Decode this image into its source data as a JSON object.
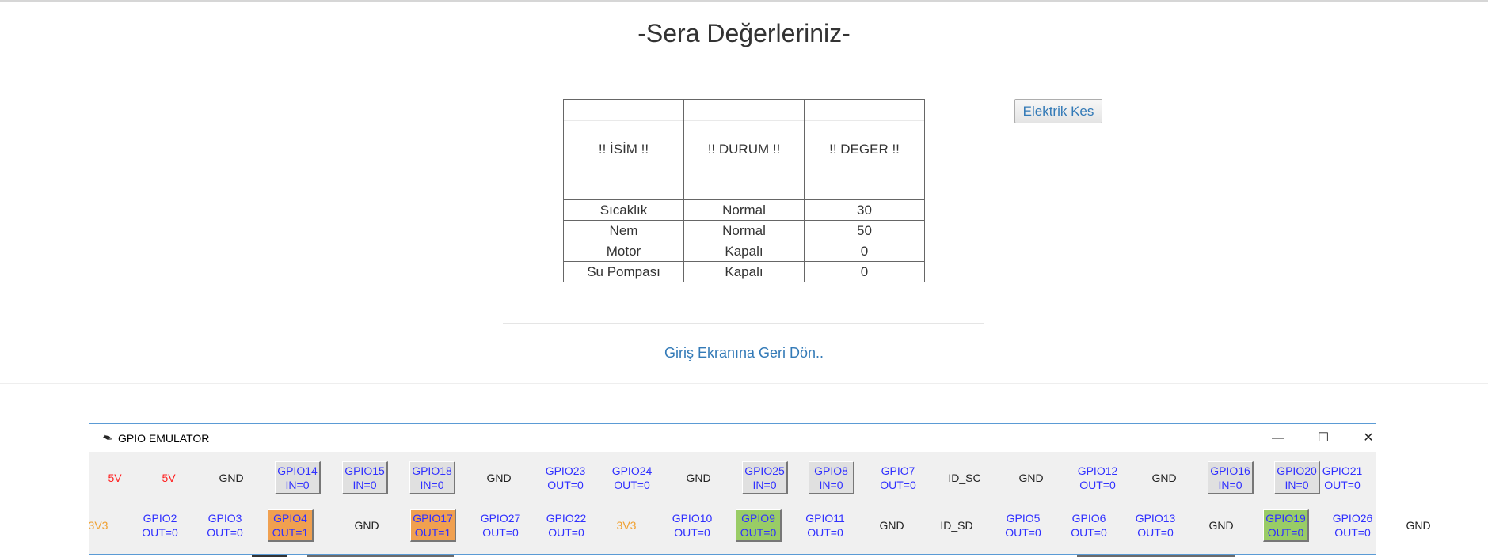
{
  "page": {
    "title": "-Sera Değerleriniz-",
    "cut_button": "Elektrik Kes",
    "back_link": "Giriş Ekranına Geri Dön.."
  },
  "table": {
    "headers": [
      "!! İSİM !!",
      "!! DURUM !!",
      "!! DEGER !!"
    ],
    "rows": [
      [
        "Sıcaklık",
        "Normal",
        "30"
      ],
      [
        "Nem",
        "Normal",
        "50"
      ],
      [
        "Motor",
        "Kapalı",
        "0"
      ],
      [
        "Su Pompası",
        "Kapalı",
        "0"
      ]
    ]
  },
  "emulator": {
    "title": "GPIO EMULATOR",
    "controls": {
      "minimize": "—",
      "maximize": "☐",
      "close": "✕"
    },
    "colors": {
      "power_5v": "#ff2020",
      "power_3v3": "#f0a030",
      "gpio_text": "#3030ff",
      "high": "#f0a050",
      "green": "#99cc66"
    },
    "row1": [
      {
        "l1": "5V",
        "l2": "",
        "kind": "5v"
      },
      {
        "l1": "5V",
        "l2": "",
        "kind": "5v"
      },
      {
        "l1": "GND",
        "l2": "",
        "kind": "gnd"
      },
      {
        "l1": "GPIO14",
        "l2": "IN=0",
        "kind": "in"
      },
      {
        "l1": "GPIO15",
        "l2": "IN=0",
        "kind": "in"
      },
      {
        "l1": "GPIO18",
        "l2": "IN=0",
        "kind": "in"
      },
      {
        "l1": "GND",
        "l2": "",
        "kind": "gnd"
      },
      {
        "l1": "GPIO23",
        "l2": "OUT=0",
        "kind": "out"
      },
      {
        "l1": "GPIO24",
        "l2": "OUT=0",
        "kind": "out"
      },
      {
        "l1": "GND",
        "l2": "",
        "kind": "gnd"
      },
      {
        "l1": "GPIO25",
        "l2": "IN=0",
        "kind": "in"
      },
      {
        "l1": "GPIO8",
        "l2": "IN=0",
        "kind": "in"
      },
      {
        "l1": "GPIO7",
        "l2": "OUT=0",
        "kind": "out"
      },
      {
        "l1": "ID_SC",
        "l2": "",
        "kind": "gnd"
      },
      {
        "l1": "GND",
        "l2": "",
        "kind": "gnd"
      },
      {
        "l1": "GPIO12",
        "l2": "OUT=0",
        "kind": "out"
      },
      {
        "l1": "GND",
        "l2": "",
        "kind": "gnd"
      },
      {
        "l1": "GPIO16",
        "l2": "IN=0",
        "kind": "in"
      },
      {
        "l1": "GPIO20",
        "l2": "IN=0",
        "kind": "in"
      },
      {
        "l1": "GPIO21",
        "l2": "OUT=0",
        "kind": "out"
      }
    ],
    "row2": [
      {
        "l1": "3V3",
        "l2": "",
        "kind": "3v3"
      },
      {
        "l1": "GPIO2",
        "l2": "OUT=0",
        "kind": "out"
      },
      {
        "l1": "GPIO3",
        "l2": "OUT=0",
        "kind": "out"
      },
      {
        "l1": "GPIO4",
        "l2": "OUT=1",
        "kind": "high"
      },
      {
        "l1": "GND",
        "l2": "",
        "kind": "gnd"
      },
      {
        "l1": "GPIO17",
        "l2": "OUT=1",
        "kind": "high"
      },
      {
        "l1": "GPIO27",
        "l2": "OUT=0",
        "kind": "out"
      },
      {
        "l1": "GPIO22",
        "l2": "OUT=0",
        "kind": "out"
      },
      {
        "l1": "3V3",
        "l2": "",
        "kind": "3v3"
      },
      {
        "l1": "GPIO10",
        "l2": "OUT=0",
        "kind": "out"
      },
      {
        "l1": "GPIO9",
        "l2": "OUT=0",
        "kind": "green"
      },
      {
        "l1": "GPIO11",
        "l2": "OUT=0",
        "kind": "out"
      },
      {
        "l1": "GND",
        "l2": "",
        "kind": "gnd"
      },
      {
        "l1": "ID_SD",
        "l2": "",
        "kind": "gnd"
      },
      {
        "l1": "GPIO5",
        "l2": "OUT=0",
        "kind": "out"
      },
      {
        "l1": "GPIO6",
        "l2": "OUT=0",
        "kind": "out"
      },
      {
        "l1": "GPIO13",
        "l2": "OUT=0",
        "kind": "out"
      },
      {
        "l1": "GND",
        "l2": "",
        "kind": "gnd"
      },
      {
        "l1": "GPIO19",
        "l2": "OUT=0",
        "kind": "green"
      },
      {
        "l1": "GPIO26",
        "l2": "OUT=0",
        "kind": "out"
      },
      {
        "l1": "GND",
        "l2": "",
        "kind": "gnd"
      }
    ]
  }
}
